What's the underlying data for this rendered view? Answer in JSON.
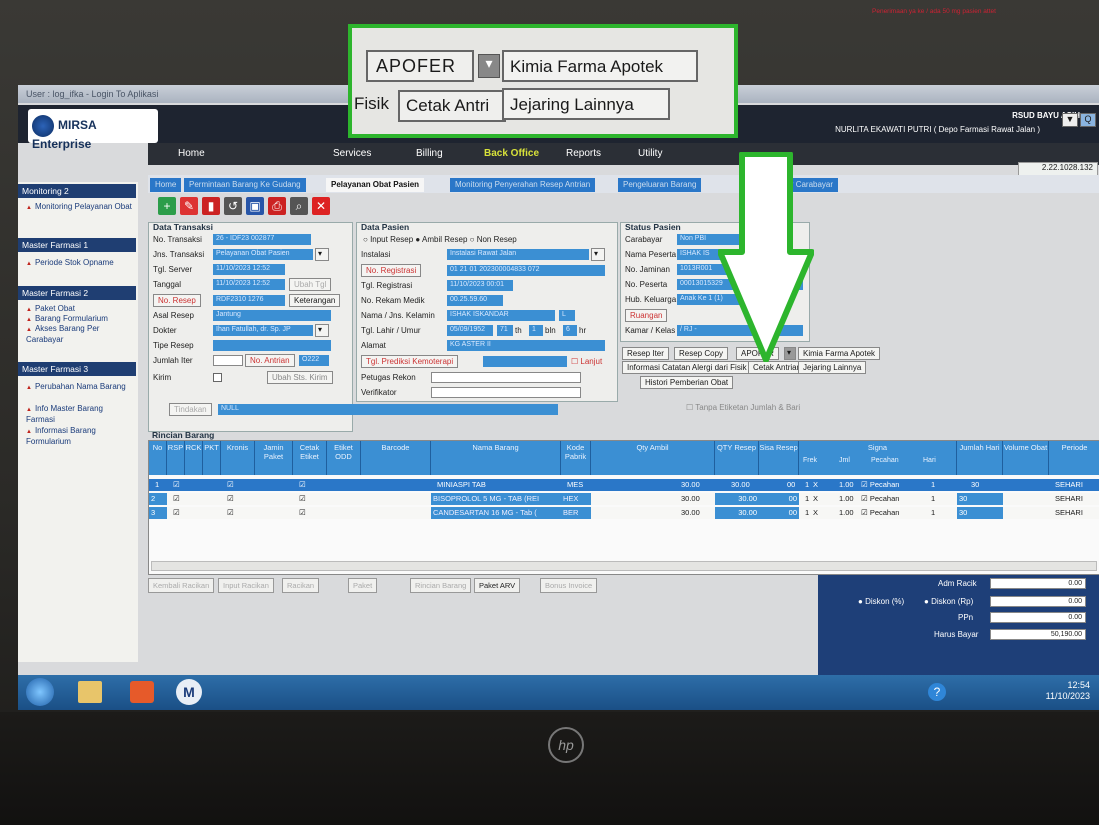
{
  "window": {
    "title": "User : log_ifka - Login To Aplikasi"
  },
  "brand": {
    "name": "MIRSA Enterprise"
  },
  "header": {
    "hospital": "RSUD BAYU ASIH",
    "user": "NURLITA EKAWATI PUTRI ( Depo Farmasi Rawat Jalan )",
    "version": "2.22.1028.132"
  },
  "menu": {
    "home": "Home",
    "services": "Services",
    "billing": "Billing",
    "back_office": "Back Office",
    "reports": "Reports",
    "utility": "Utility"
  },
  "tabs": [
    "Home",
    "Permintaan Barang Ke Gudang",
    "Pelayanan Obat Pasien",
    "Monitoring Penyerahan Resep Antrian",
    "Pengeluaran Barang",
    "Barang Per Carabayar"
  ],
  "sidebar": {
    "group1": "Monitoring 2",
    "g1_items": [
      "Monitoring Pelayanan Obat"
    ],
    "group2": "Master Farmasi 1",
    "g2_items": [
      "Periode Stok Opname"
    ],
    "group3": "Master Farmasi 2",
    "g3_items": [
      "Paket Obat",
      "Barang Formularium",
      "Akses Barang Per Carabayar"
    ],
    "group4": "Master Farmasi 3",
    "g4_items": [
      "Perubahan Nama Barang",
      "Info Master Barang Farmasi",
      "Informasi Barang Formularium"
    ]
  },
  "transaksi": {
    "title": "Data Transaksi",
    "no_transaksi_lbl": "No. Transaksi",
    "no_transaksi": "26 - IDF23 002877",
    "jns_lbl": "Jns. Transaksi",
    "jns": "Pelayanan Obat Pasien",
    "tgl_server_lbl": "Tgl. Server",
    "tgl_server": "11/10/2023 12:52",
    "tanggal_lbl": "Tanggal",
    "tanggal": "11/10/2023 12:52",
    "ubah_tgl": "Ubah Tgl",
    "no_resep_btn": "No. Resep",
    "no_resep": "RDF2310 1276",
    "keterangan": "Keterangan",
    "asal_lbl": "Asal Resep",
    "asal": "Jantung",
    "dokter_lbl": "Dokter",
    "dokter": "Ihan Fatullah, dr. Sp. JP",
    "tipe_lbl": "Tipe Resep",
    "jumlah_lbl": "Jumlah Iter",
    "no_antrian": "No. Antrian",
    "antrian": "O222",
    "kirim_lbl": "Kirim",
    "ubah_sts": "Ubah Sts. Kirim",
    "tindakan": "Tindakan",
    "null": "NULL"
  },
  "pasien": {
    "title": "Data Pasien",
    "input_resep": "Input Resep",
    "ambil_resep": "Ambil Resep",
    "non_resep": "Non Resep",
    "instalasi_lbl": "Instalasi",
    "instalasi": "Instalasi Rawat Jalan",
    "no_reg_btn": "No. Registrasi",
    "no_reg": "01 21 01 202300004833 072",
    "tgl_reg_lbl": "Tgl. Registrasi",
    "tgl_reg": "11/10/2023 00:01",
    "no_rm_lbl": "No. Rekam Medik",
    "no_rm": "00.25.59.60",
    "nama_lbl": "Nama / Jns. Kelamin",
    "nama": "ISHAK ISKANDAR",
    "jk": "L",
    "tgl_lahir_lbl": "Tgl. Lahir / Umur",
    "tgl_lahir": "05/09/1952",
    "umur_th": "71",
    "th": "th",
    "umur_bln": "1",
    "bln": "bln",
    "umur_hr": "6",
    "hr": "hr",
    "alamat_lbl": "Alamat",
    "alamat": "KG ASTER II",
    "tgl_prediksi": "Tgl. Prediksi Kemoterapi",
    "lanjut": "Lanjut",
    "petugas_lbl": "Petugas Rekon",
    "verifikator_lbl": "Verifikator"
  },
  "status": {
    "title": "Status Pasien",
    "carabayar_lbl": "Carabayar",
    "carabayar": "Non PBI",
    "nama_peserta_lbl": "Nama Peserta",
    "nama_peserta": "ISHAK IS",
    "no_jaminan_lbl": "No. Jaminan",
    "no_jaminan": "1013R001",
    "no_peserta_lbl": "No. Peserta",
    "no_peserta": "00013015329",
    "hub_lbl": "Hub. Keluarga",
    "hub": "Anak Ke 1 (1)",
    "ruangan": "Ruangan",
    "kamar_lbl": "Kamar / Kelas",
    "kamar": "/ RJ -",
    "resep_iter": "Resep Iter",
    "resep_copy": "Resep Copy",
    "apofer": "APOFER",
    "kimia": "Kimia Farma Apotek",
    "info_alergi": "Informasi Catatan Alergi dari Fisik",
    "cetak_antri": "Cetak Antrian",
    "jejaring": "Jejaring Lainnya",
    "histori": "Histori Pemberian Obat",
    "tanpa_etiket": "Tanpa Etiketan Jumlah & Bari"
  },
  "rincian": {
    "title": "Rincian Barang",
    "headers": [
      "No",
      "RSP",
      "RCK",
      "PKT",
      "Kronis",
      "Jamin Paket",
      "Cetak Etiket",
      "Etiket ODD",
      "Barcode",
      "Nama Barang",
      "Kode Pabrik",
      "Qty Ambil",
      "QTY Resep",
      "Sisa Resep",
      "Signa",
      "Jumlah Hari",
      "Volume Obat",
      "Periode"
    ],
    "signa_sub": [
      "Frek",
      "",
      "Jml",
      "Pecahan",
      "Hari"
    ],
    "rows": [
      {
        "no": "1",
        "nama": "MINIASPI TAB",
        "kode": "MES",
        "qty": "30.00",
        "qty_resep": "30.00",
        "sisa": "00",
        "frek": "1",
        "x": "X",
        "jml": "1.00",
        "pecahan": "Pecahan",
        "hari": "1",
        "jumlah_hari": "30",
        "periode": "SEHARI"
      },
      {
        "no": "2",
        "nama": "BISOPROLOL 5 MG - TAB (REI",
        "kode": "HEX",
        "qty": "30.00",
        "qty_resep": "30.00",
        "sisa": "00",
        "frek": "1",
        "x": "X",
        "jml": "1.00",
        "pecahan": "Pecahan",
        "hari": "1",
        "jumlah_hari": "30",
        "periode": "SEHARI"
      },
      {
        "no": "3",
        "nama": "CANDESARTAN 16 MG - Tab (",
        "kode": "BER",
        "qty": "30.00",
        "qty_resep": "30.00",
        "sisa": "00",
        "frek": "1",
        "x": "X",
        "jml": "1.00",
        "pecahan": "Pecahan",
        "hari": "1",
        "jumlah_hari": "30",
        "periode": "SEHARI"
      }
    ]
  },
  "bottom": {
    "btn1": "Kembali Racikan",
    "btn2": "Input Racikan",
    "btn3": "Racikan",
    "btn4": "Paket",
    "btn5": "Rincian Barang",
    "btn6": "Paket ARV",
    "btn7": "Bonus Invoice"
  },
  "totals": {
    "adm_lbl": "Adm Racik",
    "adm": "0.00",
    "diskon_pct": "Diskon (%)",
    "diskon_rp": "Diskon (Rp)",
    "diskon": "0.00",
    "ppn_lbl": "PPn",
    "ppn": "0.00",
    "harus_lbl": "Harus Bayar",
    "harus": "50,190.00"
  },
  "taskbar": {
    "time": "12:54",
    "date": "11/10/2023"
  },
  "zoom": {
    "apofer": "APOFER",
    "kimia": "Kimia Farma Apotek",
    "fisik": "Fisik",
    "cetak": "Cetak Antri",
    "jejaring": "Jejaring Lainnya"
  },
  "note": {
    "text": "Penerimaan ya ke / ada 50 mg pasien attet"
  },
  "monitor": {
    "brand": "hp"
  },
  "colors": {
    "field": "#3b8fd3",
    "accent": "#2db52d",
    "header": "#1f3e72"
  }
}
